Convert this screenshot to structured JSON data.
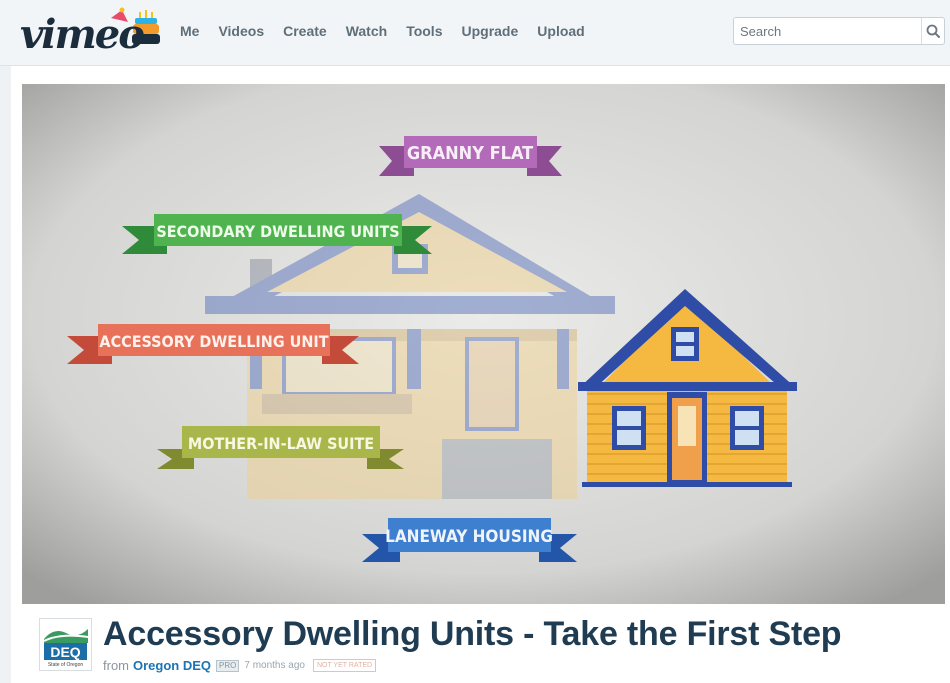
{
  "app": {
    "logo_text": "vimeo"
  },
  "nav": {
    "items": [
      "Me",
      "Videos",
      "Create",
      "Watch",
      "Tools",
      "Upgrade",
      "Upload"
    ]
  },
  "search": {
    "placeholder": "Search",
    "icon": "search-icon"
  },
  "video": {
    "banners": {
      "granny_flat": "GRANNY FLAT",
      "secondary": "SECONDARY DWELLING UNITS",
      "accessory": "ACCESSORY DWELLING UNIT",
      "mother_in_law": "MOTHER-IN-LAW SUITE",
      "laneway": "LANEWAY HOUSING"
    },
    "banner_colors": {
      "granny_flat": "#b36ab8",
      "secondary": "#4fb34f",
      "accessory": "#e8715a",
      "mother_in_law": "#a9b64a",
      "laneway": "#3f7fd0"
    }
  },
  "details": {
    "title": "Accessory Dwelling Units - Take the First Step",
    "from_label": "from",
    "owner": "Oregon DEQ",
    "badge": "PRO",
    "posted": "7 months ago",
    "rating": "NOT YET RATED",
    "avatar_text": "DEQ",
    "avatar_caption": "State of Oregon"
  },
  "colors": {
    "title": "#1f3c52",
    "link": "#1a75b4",
    "nav": "#5f6f7a"
  }
}
